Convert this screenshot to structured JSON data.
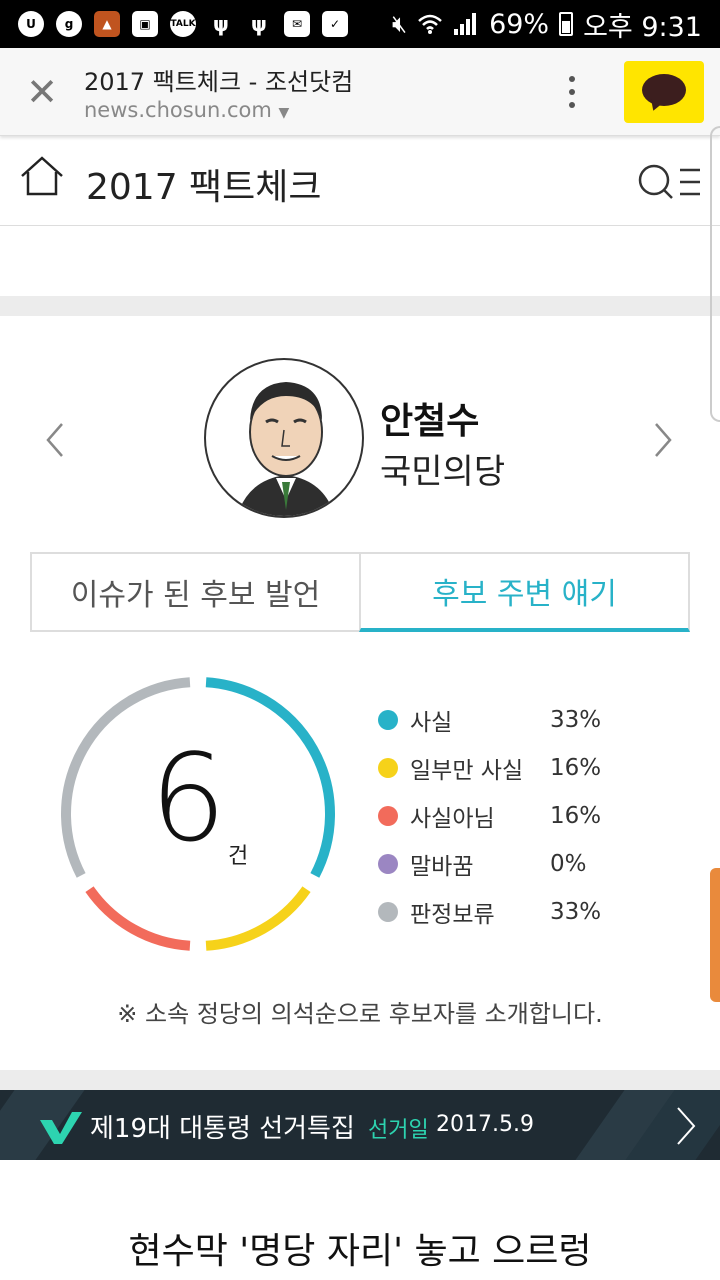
{
  "status_bar": {
    "battery": "69%",
    "time": "오후 9:31",
    "icons": [
      "u-app-icon",
      "g-app-icon",
      "game-icon",
      "image-icon",
      "talk-icon",
      "usb-icon",
      "usb-icon",
      "mail-icon",
      "clipboard-icon",
      "mute-icon",
      "wifi-icon",
      "signal-icon",
      "battery-icon"
    ],
    "talk_label": "TALK"
  },
  "browser": {
    "title": "2017 팩트체크 - 조선닷컴",
    "url": "news.chosun.com"
  },
  "header": {
    "title": "2017 팩트체크"
  },
  "candidate": {
    "name": "안철수",
    "party": "국민의당"
  },
  "tabs": [
    {
      "label": "이슈가 된 후보 발언",
      "active": false
    },
    {
      "label": "후보 주변 얘기",
      "active": true
    }
  ],
  "chart_data": {
    "type": "pie",
    "center_value": "6",
    "center_unit": "건",
    "categories": [
      "사실",
      "일부만 사실",
      "사실아님",
      "말바꿈",
      "판정보류"
    ],
    "values": [
      33,
      16,
      16,
      0,
      33
    ],
    "labels": [
      "33%",
      "16%",
      "16%",
      "0%",
      "33%"
    ],
    "colors": [
      "#28b2c8",
      "#f6d21a",
      "#f26b5b",
      "#9b86c2",
      "#b3b8bc"
    ]
  },
  "notice": "※ 소속 정당의 의석순으로 후보자를 소개합니다.",
  "banner": {
    "title": "제19대 대통령 선거특집",
    "date_label": "선거일",
    "date": "2017.5.9"
  },
  "headline": "현수막 '명당 자리' 놓고 으르렁"
}
